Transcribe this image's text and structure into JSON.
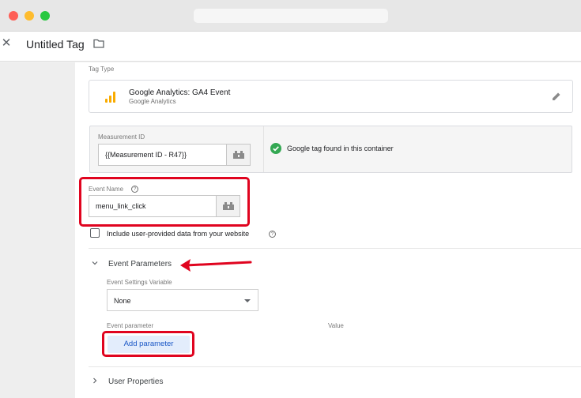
{
  "header": {
    "title": "Untitled Tag"
  },
  "tag_type": {
    "section_label": "Tag Type",
    "name": "Google Analytics: GA4 Event",
    "subtitle": "Google Analytics"
  },
  "measurement": {
    "label": "Measurement ID",
    "value": "{{Measurement ID - R47}}",
    "status_text": "Google tag found in this container"
  },
  "event_name": {
    "label": "Event Name",
    "value": "menu_link_click"
  },
  "user_data": {
    "label": "Include user-provided data from your website"
  },
  "event_parameters": {
    "title": "Event Parameters",
    "settings_label": "Event Settings Variable",
    "settings_value": "None",
    "col_parameter": "Event parameter",
    "col_value": "Value",
    "add_button": "Add parameter"
  },
  "user_properties": {
    "title": "User Properties"
  },
  "colors": {
    "annotation": "#e0041f",
    "ga_orange": "#f9ab00",
    "success_green": "#34a853",
    "button_blue": "#1a57c6"
  },
  "icons": [
    "close-icon",
    "folder-icon",
    "google-analytics-icon",
    "pencil-icon",
    "variable-picker-icon",
    "check-circle-icon",
    "help-icon",
    "chevron-down-icon",
    "chevron-right-icon",
    "dropdown-caret-icon"
  ]
}
